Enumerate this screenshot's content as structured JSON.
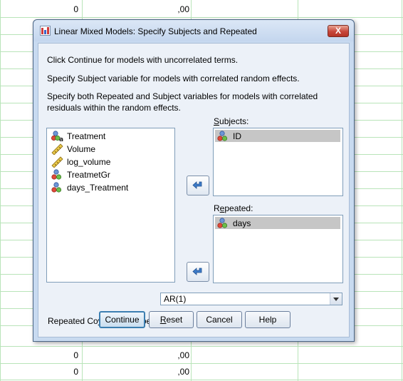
{
  "spreadsheet": {
    "rows": [
      {
        "col1": "0",
        "col2": ",00"
      },
      {
        "col1": "0",
        "col2": ",00"
      },
      {
        "col1": "0",
        "col2": ",00"
      }
    ]
  },
  "dialog": {
    "title": "Linear Mixed Models: Specify Subjects and Repeated",
    "close_label": "X",
    "instructions": [
      "Click Continue for models with uncorrelated terms.",
      "Specify Subject variable for models with correlated random effects.",
      "Specify both Repeated and Subject variables for models with correlated residuals within the random effects."
    ],
    "variables": [
      {
        "label": "Treatment",
        "icon": "nominal-string-icon"
      },
      {
        "label": "Volume",
        "icon": "scale-ruler-icon"
      },
      {
        "label": "log_volume",
        "icon": "scale-ruler-icon"
      },
      {
        "label": "TreatmetGr",
        "icon": "nominal-icon"
      },
      {
        "label": "days_Treatment",
        "icon": "nominal-icon"
      }
    ],
    "subjects": {
      "label_pre": "",
      "label_u": "S",
      "label_post": "ubjects:",
      "items": [
        "ID"
      ]
    },
    "repeated": {
      "label_pre": "R",
      "label_u": "e",
      "label_post": "peated:",
      "items": [
        "days"
      ]
    },
    "covariance": {
      "label_pre": "Repeated Co",
      "label_u": "v",
      "label_post": "ariance Type:",
      "value": "AR(1)"
    },
    "buttons": {
      "continue": "Continue",
      "reset_u": "R",
      "reset_rest": "eset",
      "cancel": "Cancel",
      "help": "Help"
    },
    "colors": {
      "accent": "#3c7fb1",
      "selected_row": "#c6c6c6",
      "close_button": "#c7463a"
    }
  }
}
